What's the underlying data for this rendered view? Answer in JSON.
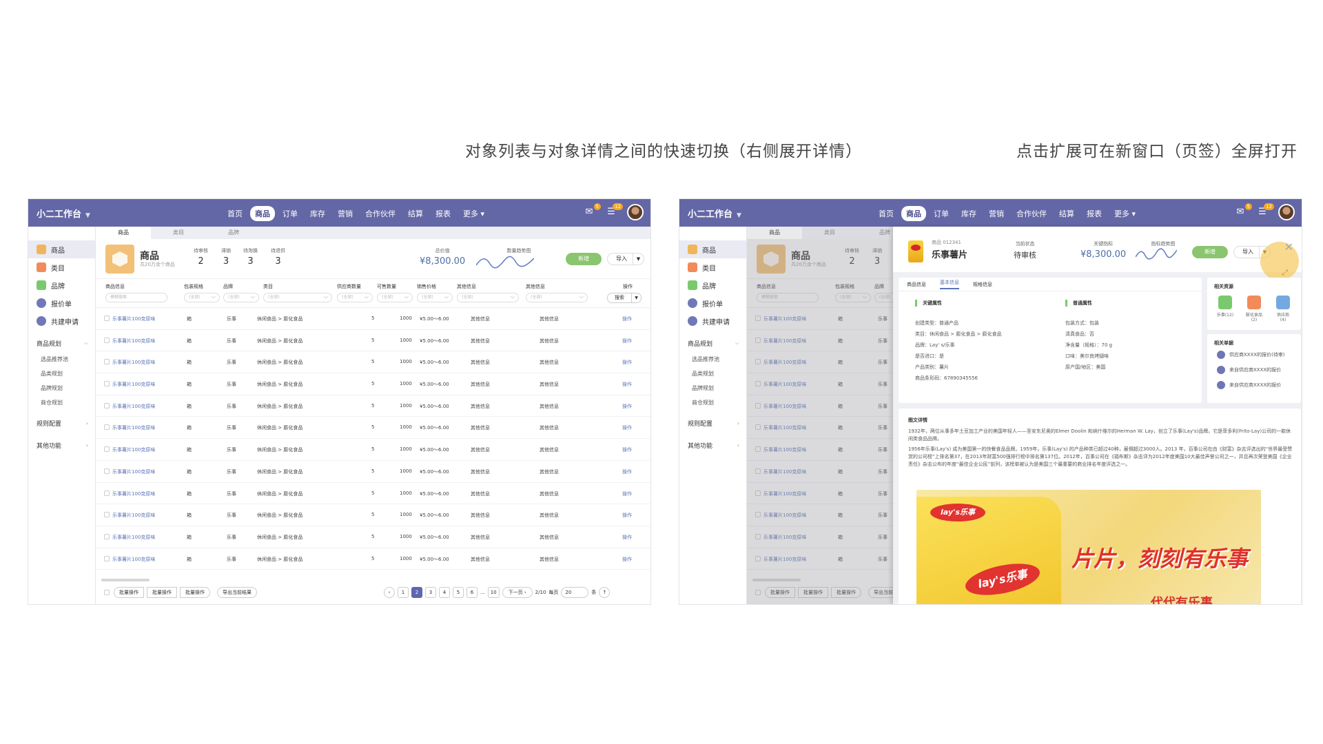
{
  "captions": {
    "left": "对象列表与对象详情之间的快速切换（右侧展开详情）",
    "right": "点击扩展可在新窗口（页签）全屏打开"
  },
  "app": {
    "brand": "小二工作台",
    "nav": [
      "首页",
      "商品",
      "订单",
      "库存",
      "营销",
      "合作伙伴",
      "结算",
      "报表",
      "更多 ▾"
    ],
    "nav_active": 1,
    "badges": {
      "message": "5",
      "tasks": "12"
    }
  },
  "tabs": [
    "商品",
    "类目",
    "品牌"
  ],
  "sidebar": {
    "items": [
      {
        "label": "商品",
        "icon": "product-icon"
      },
      {
        "label": "类目",
        "icon": "category-icon"
      },
      {
        "label": "品牌",
        "icon": "brand-icon"
      },
      {
        "label": "报价单",
        "icon": "quote-icon"
      },
      {
        "label": "共建申请",
        "icon": "apply-icon"
      }
    ],
    "group1": "商品规划",
    "sub": [
      "选品推荐池",
      "品类规划",
      "品牌规划",
      "商仓规划"
    ],
    "group2": "规则配置",
    "group3": "其他功能"
  },
  "header": {
    "title": "商品",
    "subtitle": "共20万余个商品",
    "stats": [
      {
        "label": "待审核",
        "value": "2"
      },
      {
        "label": "滞销",
        "value": "3"
      },
      {
        "label": "待淘换",
        "value": "3"
      },
      {
        "label": "待退供",
        "value": "3"
      }
    ],
    "total_label": "总价值",
    "total_value": "¥8,300.00",
    "trend_label": "数量趋势图",
    "new_label": "新增",
    "import_label": "导入"
  },
  "filters": {
    "columns": [
      "商品信息",
      "包装规格",
      "品牌",
      "类目",
      "供应商数量",
      "可售数量",
      "销售价格",
      "其他信息",
      "其他信息",
      "操作"
    ],
    "search_placeholder": "模糊搜索",
    "all_placeholder": "(全部)",
    "search_button": "搜索"
  },
  "table": {
    "rows": [
      {
        "name": "乐事薯片100克原味",
        "pack": "箱",
        "brand": "乐事",
        "category": "休闲食品 > 膨化食品",
        "suppliers": "5",
        "stock": "1000",
        "price": "¥5.00～6.00",
        "other1": "其他信息",
        "other2": "其他信息",
        "op": "操作"
      },
      {
        "name": "乐事薯片100克原味",
        "pack": "箱",
        "brand": "乐事",
        "category": "休闲食品 > 膨化食品",
        "suppliers": "5",
        "stock": "1000",
        "price": "¥5.00～6.00",
        "other1": "其他信息",
        "other2": "其他信息",
        "op": "操作"
      },
      {
        "name": "乐事薯片100克原味",
        "pack": "箱",
        "brand": "乐事",
        "category": "休闲食品 > 膨化食品",
        "suppliers": "5",
        "stock": "1000",
        "price": "¥5.00～6.00",
        "other1": "其他信息",
        "other2": "其他信息",
        "op": "操作"
      },
      {
        "name": "乐事薯片100克原味",
        "pack": "箱",
        "brand": "乐事",
        "category": "休闲食品 > 膨化食品",
        "suppliers": "5",
        "stock": "1000",
        "price": "¥5.00～6.00",
        "other1": "其他信息",
        "other2": "其他信息",
        "op": "操作"
      },
      {
        "name": "乐事薯片100克原味",
        "pack": "箱",
        "brand": "乐事",
        "category": "休闲食品 > 膨化食品",
        "suppliers": "5",
        "stock": "1000",
        "price": "¥5.00～6.00",
        "other1": "其他信息",
        "other2": "其他信息",
        "op": "操作"
      },
      {
        "name": "乐事薯片100克原味",
        "pack": "箱",
        "brand": "乐事",
        "category": "休闲食品 > 膨化食品",
        "suppliers": "5",
        "stock": "1000",
        "price": "¥5.00～6.00",
        "other1": "其他信息",
        "other2": "其他信息",
        "op": "操作"
      },
      {
        "name": "乐事薯片100克原味",
        "pack": "箱",
        "brand": "乐事",
        "category": "休闲食品 > 膨化食品",
        "suppliers": "5",
        "stock": "1000",
        "price": "¥5.00～6.00",
        "other1": "其他信息",
        "other2": "其他信息",
        "op": "操作"
      },
      {
        "name": "乐事薯片100克原味",
        "pack": "箱",
        "brand": "乐事",
        "category": "休闲食品 > 膨化食品",
        "suppliers": "5",
        "stock": "1000",
        "price": "¥5.00～6.00",
        "other1": "其他信息",
        "other2": "其他信息",
        "op": "操作"
      },
      {
        "name": "乐事薯片100克原味",
        "pack": "箱",
        "brand": "乐事",
        "category": "休闲食品 > 膨化食品",
        "suppliers": "5",
        "stock": "1000",
        "price": "¥5.00～6.00",
        "other1": "其他信息",
        "other2": "其他信息",
        "op": "操作"
      },
      {
        "name": "乐事薯片100克原味",
        "pack": "箱",
        "brand": "乐事",
        "category": "休闲食品 > 膨化食品",
        "suppliers": "5",
        "stock": "1000",
        "price": "¥5.00～6.00",
        "other1": "其他信息",
        "other2": "其他信息",
        "op": "操作"
      },
      {
        "name": "乐事薯片100克原味",
        "pack": "箱",
        "brand": "乐事",
        "category": "休闲食品 > 膨化食品",
        "suppliers": "5",
        "stock": "1000",
        "price": "¥5.00～6.00",
        "other1": "其他信息",
        "other2": "其他信息",
        "op": "操作"
      },
      {
        "name": "乐事薯片100克原味",
        "pack": "箱",
        "brand": "乐事",
        "category": "休闲食品 > 膨化食品",
        "suppliers": "5",
        "stock": "1000",
        "price": "¥5.00～6.00",
        "other1": "其他信息",
        "other2": "其他信息",
        "op": "操作"
      }
    ]
  },
  "footer": {
    "batch": [
      "批量操作",
      "批量操作",
      "批量操作"
    ],
    "export": "导出当前结果",
    "pages": [
      "1",
      "2",
      "3",
      "4",
      "5",
      "6",
      "...",
      "10"
    ],
    "page_active": "2",
    "next": "下一页",
    "page_info": "2/10",
    "per_page_label": "每页",
    "per_page": "20",
    "unit": "条"
  },
  "detail": {
    "code": "商品 012341",
    "title": "乐事薯片",
    "status_label": "当前状态",
    "status_value": "待审核",
    "key_label": "关键指标",
    "key_value": "¥8,300.00",
    "kpi_label": "指标趋势图",
    "tabs": [
      "商品信息",
      "基本信息",
      "规格信息"
    ],
    "key_props_title": "关键属性",
    "key_props": [
      "创建类型：普通产品",
      "类目：休闲食品 > 膨化食品 > 膨化食品",
      "品牌：Lay' s/乐事",
      "是否进口：是",
      "产品类别：薯片",
      "商品条形码：67890345556"
    ],
    "normal_props_title": "普通属性",
    "normal_props": [
      "包装方式：包装",
      "清真食品：否",
      "净含量（规格）：70 g",
      "口味：美尔良烤翅味",
      "原产国/地区：美国"
    ],
    "resources_title": "相关资源",
    "resources": [
      {
        "label": "乐事(12)"
      },
      {
        "label": "膨化食品\n(2)"
      },
      {
        "label": "供应商\n(4)"
      }
    ],
    "docs_title": "相关单据",
    "docs": [
      "供应商XXXX的报价(待审)",
      "来自供应商XXXX的报价",
      "来自供应商XXXX的报价"
    ],
    "rich_title": "图文详情",
    "para1": "1932年，两位从事多年土豆加工产业的美国年轻人——圣安东尼奥的Elmer Doolin 和纳什维尔的Herman W. Lay，创立了乐事(Lay's)品牌。它是菲多利(Frito-Lay)公司的一款休闲类食品品牌。",
    "para2": "1956年乐事(Lay's) 成为美国第一的快餐食品品牌。1959年，乐事(Lay's) 的产品种类已超过40种，雇佣超过3000人。2013 年，百事公司在由《财富》杂志评选出的“世界最受赞赏的公司榜”上排名第37，在2013年财富500强排行榜中排名第137位。2012年，百事公司在《福布斯》杂志评为2012年度美国10大最佳声誉公司之一，并且再次荣登美国《企业责任》杂志公布的年度“最佳企业公民”前列，该榜单被认为是美国三个最重要的商业排名年度评选之一。",
    "banner_logo": "lay's乐事",
    "banner_slogan": "片片，刻刻有乐事",
    "banner_slogan2": "代代有乐事"
  },
  "colors": {
    "topbar": "#6467a6",
    "accent_green": "#8bc56f",
    "link": "#5b73b6",
    "highlight": "#f5c450"
  }
}
